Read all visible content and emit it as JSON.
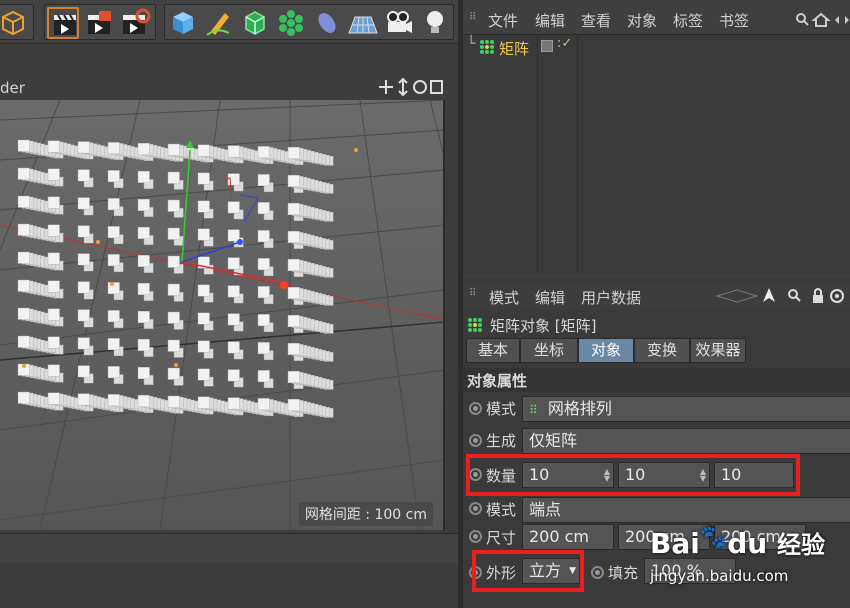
{
  "viewport": {
    "title_fragment": "der",
    "grid_spacing": "网格间距 : 100 cm",
    "header_icons": [
      "move-icon",
      "up-down-icon",
      "rotate-icon",
      "layout-icon"
    ]
  },
  "toolbar": {
    "icons": [
      "cube-menu-icon",
      "render-view-icon",
      "render-active-icon",
      "render-settings-icon",
      "cube-primitive-icon",
      "pen-icon",
      "subdivision-icon",
      "mograph-cloner-icon",
      "deformer-icon",
      "floor-icon",
      "camera-icon",
      "light-icon"
    ]
  },
  "object_manager": {
    "menu": [
      "文件",
      "编辑",
      "查看",
      "对象",
      "标签",
      "书签"
    ],
    "objects": [
      {
        "name": "矩阵",
        "icon": "matrix-icon",
        "color": "#f2c94c"
      }
    ],
    "right_icons": [
      "search-icon",
      "home-icon",
      "nav-icon"
    ]
  },
  "attribute_manager": {
    "menu": [
      "模式",
      "编辑",
      "用户数据"
    ],
    "title": "矩阵对象 [矩阵]",
    "tabs": [
      {
        "label": "基本",
        "active": false
      },
      {
        "label": "坐标",
        "active": false
      },
      {
        "label": "对象",
        "active": true
      },
      {
        "label": "变换",
        "active": false
      },
      {
        "label": "效果器",
        "active": false
      }
    ],
    "section_title": "对象属性",
    "mode_label": "模式",
    "mode_value": "网格排列",
    "generate_label": "生成",
    "generate_value": "仅矩阵",
    "count_label": "数量",
    "count_values": [
      "10",
      "10",
      "10"
    ],
    "mode2_label": "模式",
    "mode2_value": "端点",
    "size_label": "尺寸",
    "size_values": [
      "200 cm",
      "200 cm",
      "200 cm"
    ],
    "shape_label": "外形",
    "shape_value": "立方",
    "fill_label": "填充",
    "fill_value": "100 %"
  },
  "watermark": {
    "brand": "Bai",
    "brand2": "du",
    "cn": "经验",
    "url": "jingyan.baidu.com"
  },
  "colors": {
    "highlight": "#e82020",
    "active_tab": "#6a87a6",
    "object_name": "#f2c94c"
  }
}
